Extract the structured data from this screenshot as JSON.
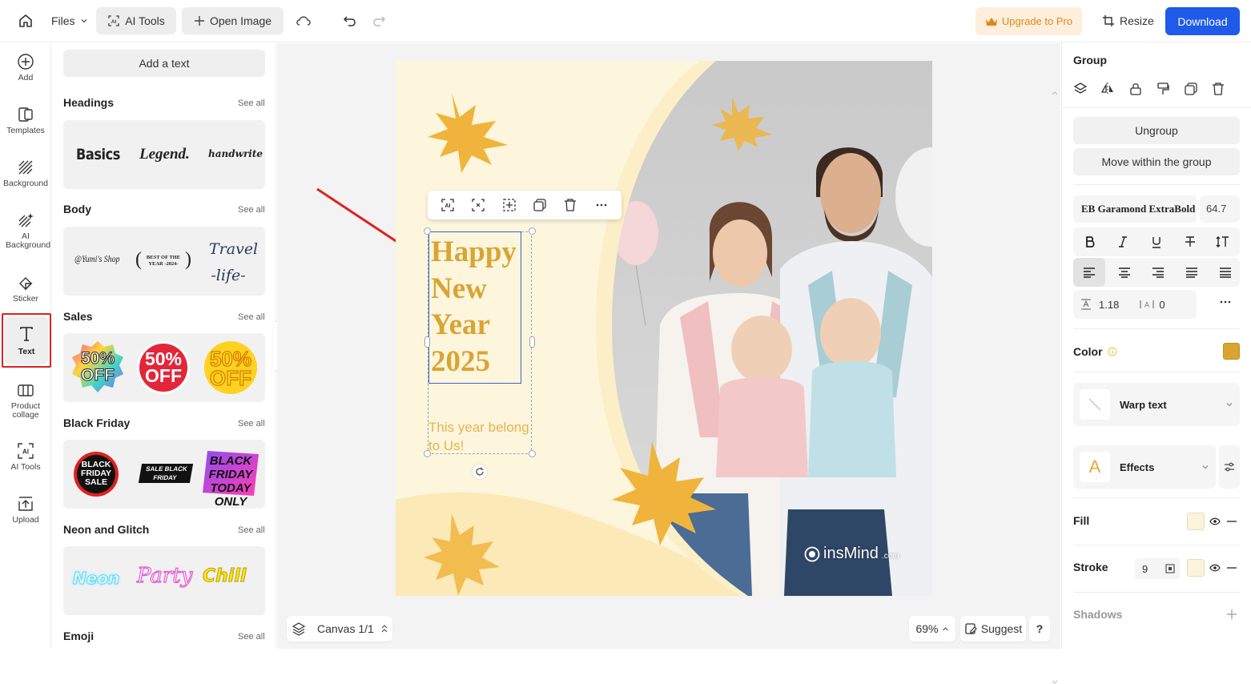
{
  "topbar": {
    "files_label": "Files",
    "ai_tools_label": "AI Tools",
    "open_image_label": "Open Image",
    "upgrade_label": "Upgrade to Pro",
    "resize_label": "Resize",
    "download_label": "Download"
  },
  "rail": [
    {
      "label": "Add",
      "icon": "plus-circle-icon"
    },
    {
      "label": "Templates",
      "icon": "templates-icon"
    },
    {
      "label": "Background",
      "icon": "background-icon"
    },
    {
      "label": "AI Background",
      "icon": "ai-background-icon"
    },
    {
      "label": "Sticker",
      "icon": "sticker-icon"
    },
    {
      "label": "Text",
      "icon": "text-icon",
      "active": true
    },
    {
      "label": "Product collage",
      "icon": "product-collage-icon"
    },
    {
      "label": "AI Tools",
      "icon": "ai-tools-icon"
    },
    {
      "label": "Upload",
      "icon": "upload-icon"
    }
  ],
  "panel": {
    "add_text_label": "Add a text",
    "see_all": "See all",
    "sections": [
      {
        "title": "Headings",
        "samples": [
          "Basics",
          "Legend.",
          "handwrite"
        ]
      },
      {
        "title": "Body",
        "samples": [
          "@Yumi's Shop",
          "BEST OF THE YEAR -2024-",
          "Travel -life-"
        ]
      },
      {
        "title": "Sales",
        "samples": [
          "50% OFF",
          "50% OFF",
          "50% OFF"
        ]
      },
      {
        "title": "Black Friday",
        "samples": [
          "BLACK FRIDAY SALE",
          "SALE BLACK FRIDAY",
          "BLACK FRIDAY TODAY ONLY"
        ]
      },
      {
        "title": "Neon and Glitch",
        "samples": [
          "Neon",
          "Party",
          "Chill"
        ]
      },
      {
        "title": "Emoji",
        "samples": []
      }
    ]
  },
  "canvas": {
    "heading_lines": [
      "Happy",
      "New",
      "Year",
      "2025"
    ],
    "subtext": "This year belong to Us!",
    "watermark": "insMind",
    "watermark_suffix": ".com",
    "canvas_label": "Canvas 1/1",
    "zoom": "69%",
    "suggest_label": "Suggest",
    "help_label": "?"
  },
  "right": {
    "group_label": "Group",
    "ungroup_label": "Ungroup",
    "move_within_label": "Move within the group",
    "font_name": "EB Garamond ExtraBold",
    "font_size": "64.7",
    "line_height": "1.18",
    "letter_spacing": "0",
    "color_label": "Color",
    "color_value": "#d9a532",
    "warp_label": "Warp text",
    "effects_label": "Effects",
    "fill_label": "Fill",
    "stroke_label": "Stroke",
    "stroke_width": "9",
    "shadows_label": "Shadows"
  },
  "colors": {
    "accent": "#1f5be8",
    "gold": "#d9a532",
    "upgrade_bg": "#fdefdc",
    "upgrade_text": "#e0871a",
    "highlight": "#e02020"
  }
}
